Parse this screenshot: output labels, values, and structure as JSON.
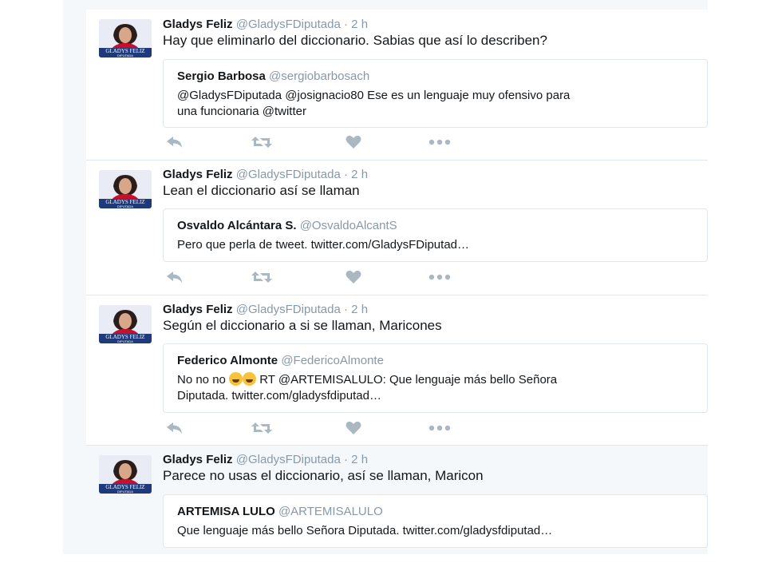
{
  "tweets": [
    {
      "name": "Gladys Feliz",
      "handle": "@GladysFDiputada",
      "time": "· 2 h",
      "text": "Hay que eliminarlo del diccionario. Sabias que así lo describen?",
      "quote": {
        "name": "Sergio Barbosa",
        "handle": "@sergiobarbosach",
        "line1": "@GladysFDiputada @josignacio80  Ese es un lenguaje muy ofensivo para",
        "line2": "una funcionaria @twitter"
      }
    },
    {
      "name": "Gladys Feliz",
      "handle": "@GladysFDiputada",
      "time": "· 2 h",
      "text": "Lean el diccionario así se llaman",
      "quote": {
        "name": "Osvaldo Alcántara S.",
        "handle": "@OsvaldoAlcantS",
        "line1": "Pero que perla de tweet.  twitter.com/GladysFDiputad…"
      }
    },
    {
      "name": "Gladys Feliz",
      "handle": "@GladysFDiputada",
      "time": "· 2 h",
      "text": "Según el diccionario a si se llaman, Maricones",
      "quote": {
        "name": "Federico Almonte",
        "handle": "@FedericoAlmonte",
        "line1_pre": "No no no",
        "line1_post": "RT @ARTEMISALULO: Que lenguaje más bello Señora",
        "line2": "Diputada.  twitter.com/gladysfdiputad…",
        "emoji": "face-with-tears-of-joy-emoji"
      }
    },
    {
      "name": "Gladys Feliz",
      "handle": "@GladysFDiputada",
      "time": "· 2 h",
      "text": "Parece no usas el diccionario, así se llaman, Maricon",
      "quote": {
        "name": "ARTEMISA LULO",
        "handle": "@ARTEMISALULO",
        "line1": "Que lenguaje más bello Señora Diputada.  twitter.com/gladysfdiputad…"
      }
    }
  ],
  "avatar": {
    "banner_text": "GLADYS FELIZ",
    "sub_text": "DIPUTADA"
  },
  "icons": {
    "reply": "reply-icon",
    "retweet": "retweet-icon",
    "like": "heart-icon",
    "more": "more-icon"
  },
  "colors": {
    "name": "#14171a",
    "muted": "#8899a6",
    "border": "#e1e8ed",
    "action": "#aab8c2",
    "avatar_banner": "#1f3a7a"
  }
}
